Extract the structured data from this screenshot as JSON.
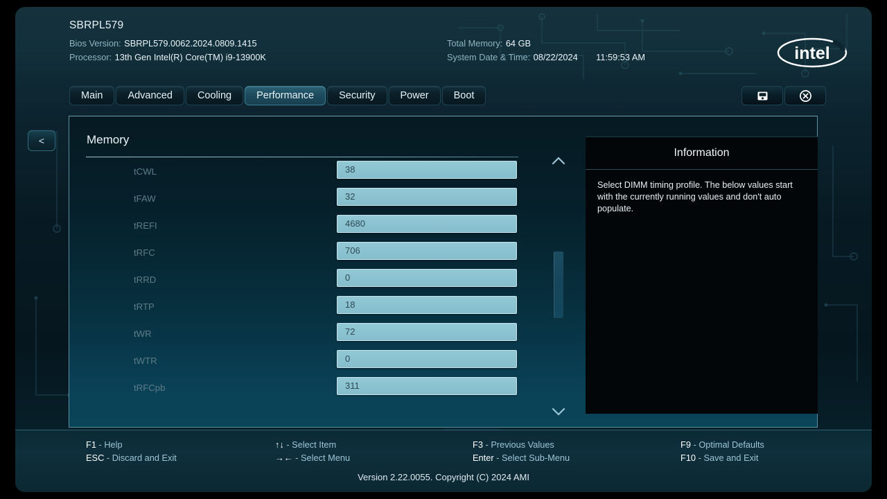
{
  "header": {
    "board_name": "SBRPL579",
    "bios_version_label": "Bios Version:",
    "bios_version_value": "SBRPL579.0062.2024.0809.1415",
    "processor_label": "Processor:",
    "processor_value": "13th Gen Intel(R) Core(TM) i9-13900K",
    "total_memory_label": "Total Memory:",
    "total_memory_value": "64 GB",
    "datetime_label": "System Date & Time:",
    "date_value": "08/22/2024",
    "time_value": "11:59:53 AM",
    "logo": "intel-logo",
    "logo_text": "intel"
  },
  "tabs": [
    {
      "label": "Main",
      "active": false
    },
    {
      "label": "Advanced",
      "active": false
    },
    {
      "label": "Cooling",
      "active": false
    },
    {
      "label": "Performance",
      "active": true
    },
    {
      "label": "Security",
      "active": false
    },
    {
      "label": "Power",
      "active": false
    },
    {
      "label": "Boot",
      "active": false
    }
  ],
  "toolbar": [
    {
      "icon": "save-icon",
      "name": "save-button"
    },
    {
      "icon": "close-circle-icon",
      "name": "exit-button"
    }
  ],
  "back_button": {
    "label": "<"
  },
  "main": {
    "section_title": "Memory",
    "rows": [
      {
        "label": "tCWL",
        "value": "38"
      },
      {
        "label": "tFAW",
        "value": "32"
      },
      {
        "label": "tREFI",
        "value": "4680"
      },
      {
        "label": "tRFC",
        "value": "706"
      },
      {
        "label": "tRRD",
        "value": "0"
      },
      {
        "label": "tRTP",
        "value": "18"
      },
      {
        "label": "tWR",
        "value": "72"
      },
      {
        "label": "tWTR",
        "value": "0"
      },
      {
        "label": "tRFCpb",
        "value": "311"
      }
    ]
  },
  "information": {
    "title": "Information",
    "body": "Select DIMM timing profile. The below values start with the currently running values and don't auto populate."
  },
  "footer": {
    "columns": [
      [
        {
          "key": "F1",
          "sep": " - ",
          "desc": "Help"
        },
        {
          "key": "ESC",
          "sep": " - ",
          "desc": "Discard and Exit"
        }
      ],
      [
        {
          "key": "↑↓",
          "sep": " - ",
          "desc": "Select Item"
        },
        {
          "key": "→←",
          "sep": " - ",
          "desc": "Select Menu"
        }
      ],
      [
        {
          "key": "F3",
          "sep": " - ",
          "desc": "Previous Values"
        },
        {
          "key": "Enter",
          "sep": " - ",
          "desc": "Select Sub-Menu"
        }
      ],
      [
        {
          "key": "F9",
          "sep": " - ",
          "desc": "Optimal Defaults"
        },
        {
          "key": "F10",
          "sep": " - ",
          "desc": "Save and Exit"
        }
      ]
    ],
    "version": "Version 2.22.0055. Copyright (C) 2024 AMI"
  },
  "colors": {
    "accent": "#2a6074",
    "input_fill": "#8cc3d1",
    "panel_border": "#5e8fa1",
    "label_dim": "#5d7c88",
    "footer_desc": "#9dc5d6"
  }
}
